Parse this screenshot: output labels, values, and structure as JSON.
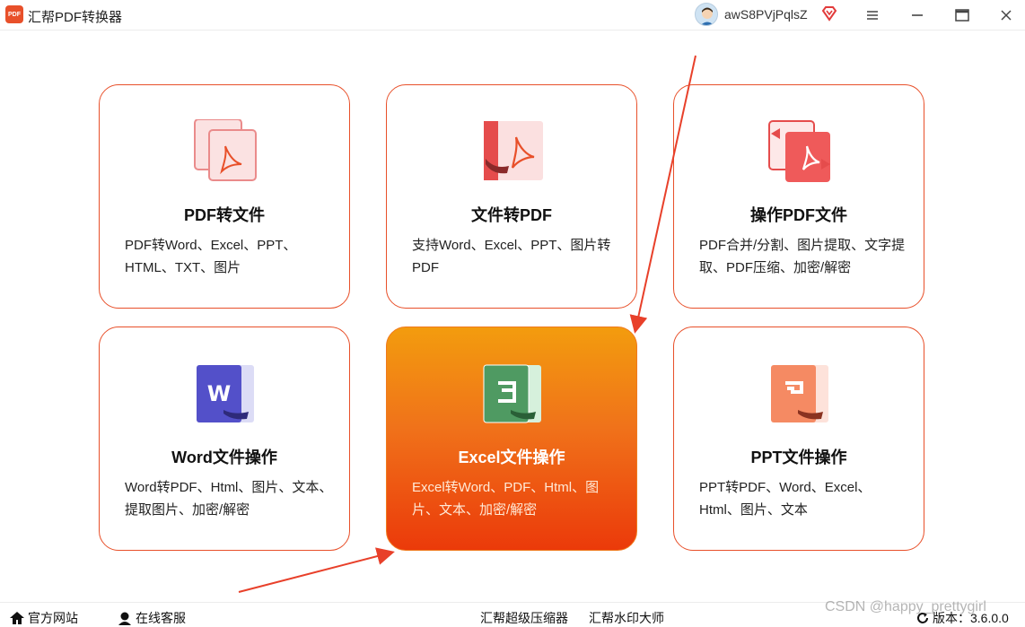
{
  "window": {
    "title": "汇帮PDF转换器",
    "logo_text": "PDF",
    "user_name": "awS8PVjPqlsZ"
  },
  "cards": [
    {
      "title": "PDF转文件",
      "desc": "PDF转Word、Excel、PPT、HTML、TXT、图片"
    },
    {
      "title": "文件转PDF",
      "desc": "支持Word、Excel、PPT、图片转PDF"
    },
    {
      "title": "操作PDF文件",
      "desc": "PDF合并/分割、图片提取、文字提取、PDF压缩、加密/解密"
    },
    {
      "title": "Word文件操作",
      "desc": "Word转PDF、Html、图片、文本、提取图片、加密/解密"
    },
    {
      "title": "Excel文件操作",
      "desc": "Excel转Word、PDF、Html、图片、文本、加密/解密"
    },
    {
      "title": "PPT文件操作",
      "desc": "PPT转PDF、Word、Excel、Html、图片、文本"
    }
  ],
  "footer": {
    "official_site": "官方网站",
    "online_service": "在线客服",
    "compressor": "汇帮超级压缩器",
    "watermark_master": "汇帮水印大师",
    "version_label": "版本：3.6.0.0"
  },
  "overlay": {
    "csdn_watermark": "CSDN @happy_prettygirl"
  },
  "colors": {
    "accent": "#e8502a",
    "active_top": "#f39c0e",
    "active_bottom": "#eb3a0a",
    "annotation_arrow": "#e8402a"
  },
  "icons": [
    "pdf-icon",
    "pdf-convert-icon",
    "pdf-operate-icon",
    "word-icon",
    "excel-icon",
    "ppt-icon",
    "menu-icon",
    "minimize-icon",
    "maximize-icon",
    "close-icon",
    "home-icon",
    "headset-icon",
    "refresh-icon"
  ]
}
